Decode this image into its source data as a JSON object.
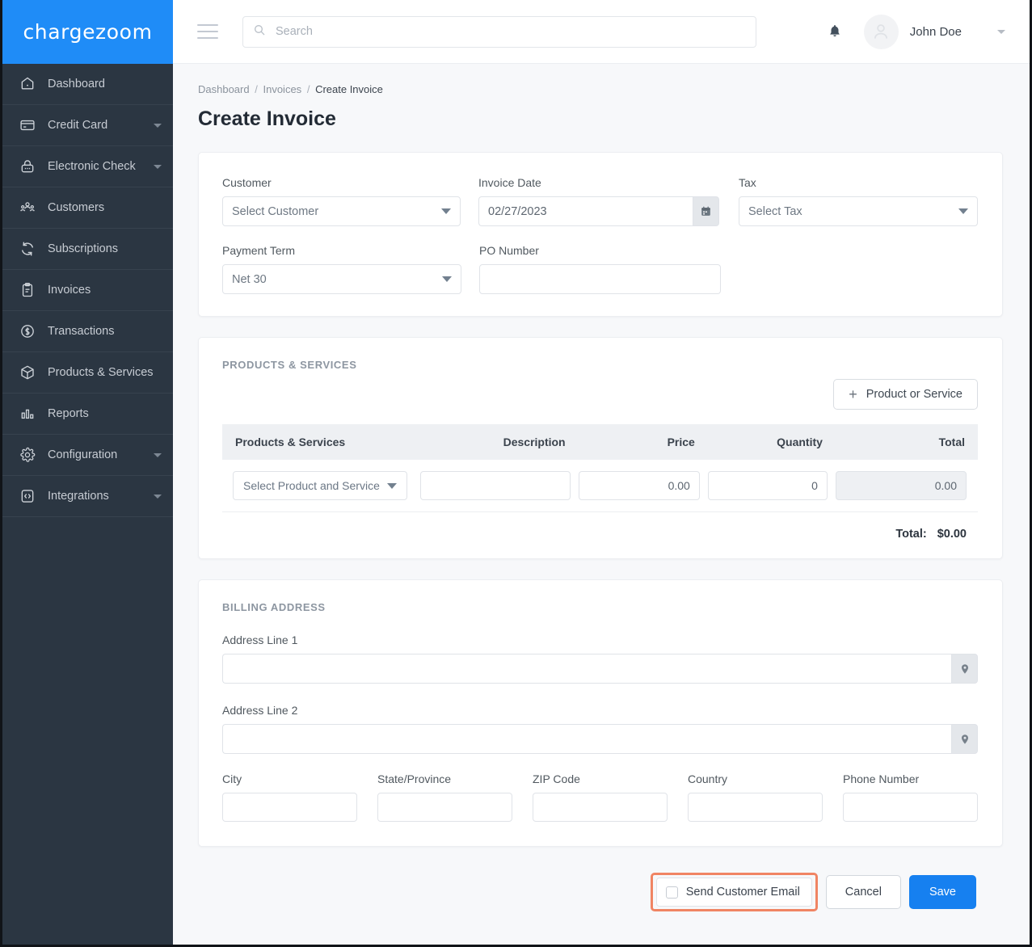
{
  "brand": {
    "name": "chargezoom",
    "bg": "#1f8cf7"
  },
  "sidebar": {
    "items": [
      {
        "label": "Dashboard",
        "icon": "dashboard-icon",
        "caret": false
      },
      {
        "label": "Credit Card",
        "icon": "credit-card-icon",
        "caret": true
      },
      {
        "label": "Electronic Check",
        "icon": "lock-icon",
        "caret": true
      },
      {
        "label": "Customers",
        "icon": "customers-icon",
        "caret": false
      },
      {
        "label": "Subscriptions",
        "icon": "refresh-icon",
        "caret": false
      },
      {
        "label": "Invoices",
        "icon": "clipboard-icon",
        "caret": false
      },
      {
        "label": "Transactions",
        "icon": "dollar-circle-icon",
        "caret": false
      },
      {
        "label": "Products & Services",
        "icon": "box-icon",
        "caret": false
      },
      {
        "label": "Reports",
        "icon": "bar-chart-icon",
        "caret": false
      },
      {
        "label": "Configuration",
        "icon": "gear-icon",
        "caret": true
      },
      {
        "label": "Integrations",
        "icon": "code-square-icon",
        "caret": true
      }
    ]
  },
  "topbar": {
    "menu_icon": "hamburger-icon",
    "search": {
      "placeholder": "Search",
      "value": "",
      "icon": "search-icon"
    },
    "notification_icon": "bell-icon",
    "avatar_icon": "user-avatar-icon",
    "user_name": "John Doe",
    "user_caret_icon": "chevron-down-icon"
  },
  "breadcrumb": {
    "items": [
      "Dashboard",
      "Invoices"
    ],
    "current": "Create Invoice",
    "separator": "/"
  },
  "page": {
    "title": "Create Invoice"
  },
  "form": {
    "customer": {
      "label": "Customer",
      "value": "Select Customer"
    },
    "invoice_date": {
      "label": "Invoice Date",
      "value": "02/27/2023",
      "icon": "calendar-icon"
    },
    "tax": {
      "label": "Tax",
      "value": "Select Tax"
    },
    "payment_term": {
      "label": "Payment Term",
      "value": "Net 30"
    },
    "po_number": {
      "label": "PO Number",
      "value": "",
      "placeholder": ""
    }
  },
  "products_section": {
    "title": "PRODUCTS & SERVICES",
    "add_button": {
      "label": "Product or Service",
      "icon": "plus-icon"
    },
    "columns": [
      "Products & Services",
      "Description",
      "Price",
      "Quantity",
      "Total"
    ],
    "rows": [
      {
        "product": "Select Product and Service",
        "description": "",
        "price": "0.00",
        "quantity": "0",
        "total": "0.00"
      }
    ],
    "total_label": "Total:",
    "total_value": "$0.00"
  },
  "billing_section": {
    "title": "BILLING ADDRESS",
    "address_line_1": {
      "label": "Address Line 1",
      "value": "",
      "icon": "map-pin-icon"
    },
    "address_line_2": {
      "label": "Address Line 2",
      "value": "",
      "icon": "map-pin-icon"
    },
    "city": {
      "label": "City",
      "value": ""
    },
    "state": {
      "label": "State/Province",
      "value": ""
    },
    "zip": {
      "label": "ZIP Code",
      "value": ""
    },
    "country": {
      "label": "Country",
      "value": ""
    },
    "phone": {
      "label": "Phone Number",
      "value": ""
    }
  },
  "footer": {
    "send_email": {
      "label": "Send Customer Email",
      "checked": false,
      "highlight_color": "#f08463"
    },
    "cancel_label": "Cancel",
    "save_label": "Save",
    "save_color": "#1680f0"
  }
}
